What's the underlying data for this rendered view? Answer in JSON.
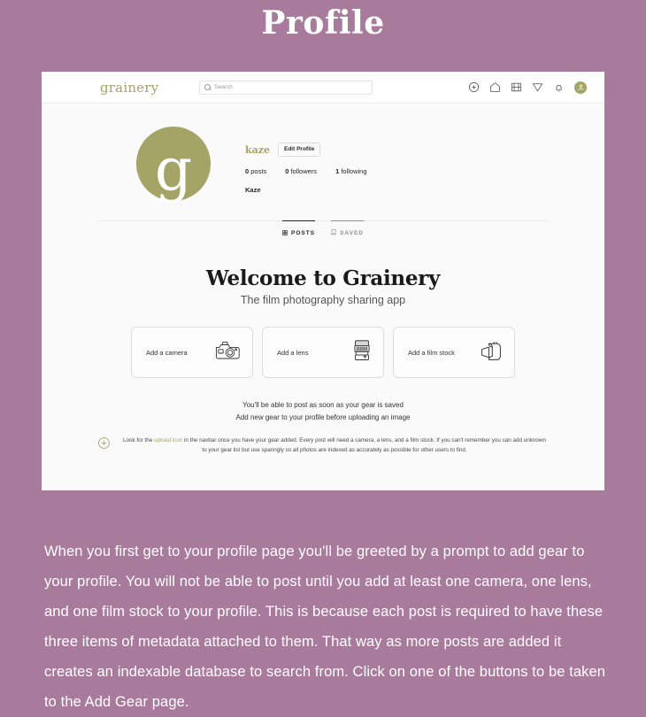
{
  "page": {
    "title": "Profile",
    "background_color": "#a87a9b",
    "accent_color": "#a3a466"
  },
  "screenshot": {
    "navbar": {
      "brand": "grainery",
      "search": {
        "placeholder": "Search",
        "value": "",
        "icon": "search-icon"
      },
      "icons": [
        {
          "name": "upload-icon",
          "label": "Upload"
        },
        {
          "name": "home-icon",
          "label": "Home"
        },
        {
          "name": "film-grid-icon",
          "label": "Explore"
        },
        {
          "name": "paper-plane-icon",
          "label": "Messages"
        },
        {
          "name": "bell-icon",
          "label": "Notifications"
        },
        {
          "name": "avatar-icon",
          "label": "Account"
        }
      ]
    },
    "profile": {
      "avatar_letter": "g",
      "username": "kaze",
      "edit_button": "Edit Profile",
      "stats": [
        {
          "count": "0",
          "label": "posts"
        },
        {
          "count": "0",
          "label": "followers"
        },
        {
          "count": "1",
          "label": "following"
        }
      ],
      "full_name": "Kaze"
    },
    "tabs": [
      {
        "label": "POSTS",
        "icon": "grid-icon",
        "active": true
      },
      {
        "label": "SAVED",
        "icon": "bookmark-icon",
        "active": false
      }
    ],
    "welcome": {
      "heading": "Welcome to Grainery",
      "subheading": "The film photography sharing app"
    },
    "gear_cards": [
      {
        "label": "Add a camera",
        "icon": "camera-icon"
      },
      {
        "label": "Add a lens",
        "icon": "lens-icon"
      },
      {
        "label": "Add a film stock",
        "icon": "film-roll-icon"
      }
    ],
    "notes": [
      "You'll be able to post as soon as your gear is saved",
      "Add new gear to your profile before uploading an image"
    ],
    "hint": {
      "icon": "circle-plus-icon",
      "text_before": "Look for the ",
      "highlight": "upload icon",
      "text_after": " in the navbar once you have your gear added. Every post will need a camera, a lens, and a film stock. If you can't remember you can add unknown to your gear list but use sparingly so all photos are indexed as accurately as possible for other users to find."
    }
  },
  "footer": {
    "paragraph": "When you first get to your profile page you'll be greeted by a prompt to add gear to your profile. You will not be able to post until you add at least one camera, one lens, and one film stock to your profile. This is because each post is required to have these three items of metadata attached to them. That way as more posts are added it creates an indexable database to search from. Click on one of the buttons to be taken to the Add Gear page."
  }
}
